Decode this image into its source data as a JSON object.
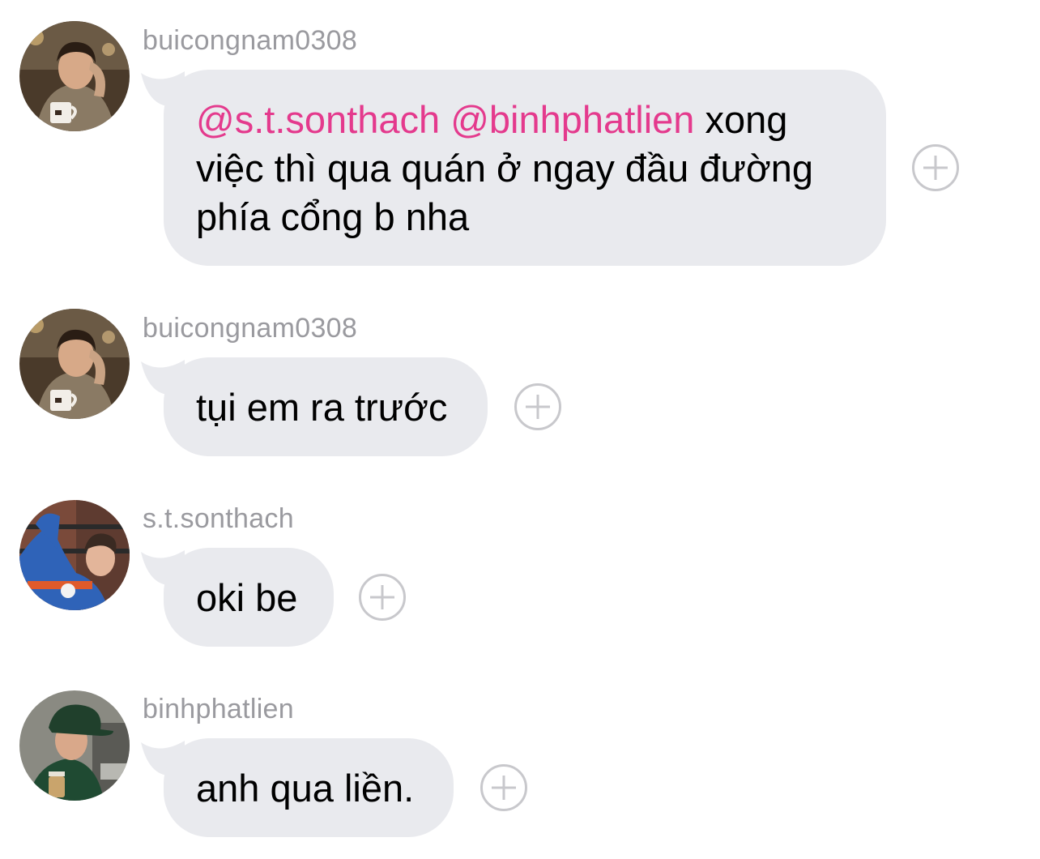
{
  "messages": [
    {
      "username": "buicongnam0308",
      "avatar_icon": "user-avatar-photo",
      "mentions": [
        "@s.t.sonthach",
        "@binhphatlien"
      ],
      "text": "xong việc thì qua quán ở ngay đầu đường phía cổng b nha",
      "text_line1": " xong",
      "text_line2": "việc thì qua quán ở ngay đầu đường",
      "text_line3": "phía cổng b nha",
      "react_icon": "add-reaction-icon"
    },
    {
      "username": "buicongnam0308",
      "avatar_icon": "user-avatar-photo",
      "text": "tụi em ra trước",
      "react_icon": "add-reaction-icon"
    },
    {
      "username": "s.t.sonthach",
      "avatar_icon": "user-avatar-photo",
      "text": "oki be",
      "react_icon": "add-reaction-icon"
    },
    {
      "username": "binhphatlien",
      "avatar_icon": "user-avatar-photo",
      "text": "anh qua liền.",
      "react_icon": "add-reaction-icon"
    }
  ],
  "colors": {
    "bubble": "#e9eaee",
    "mention": "#e43a8d",
    "username": "#9a9a9f",
    "react_icon": "#c8c8cc"
  }
}
